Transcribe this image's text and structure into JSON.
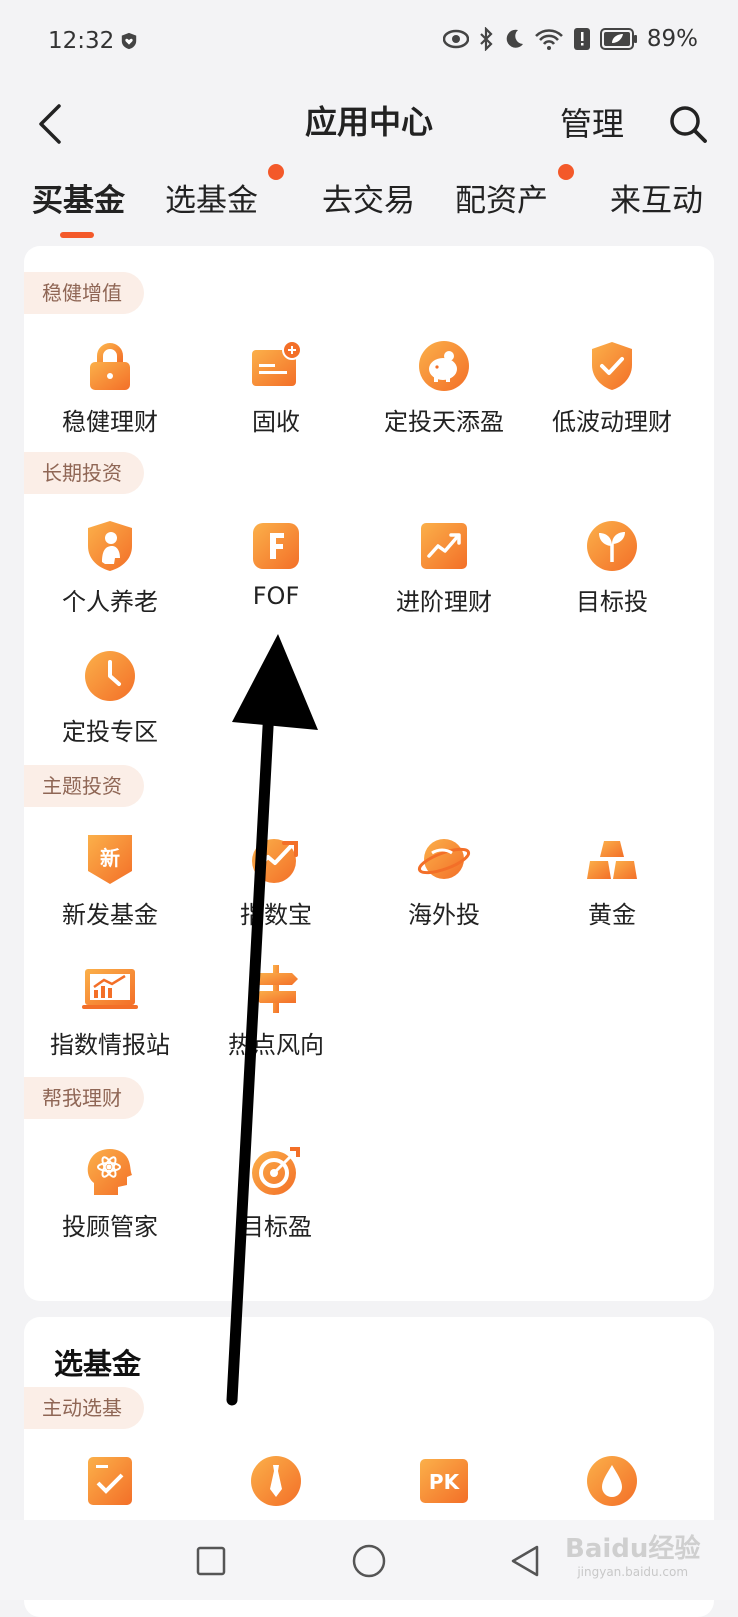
{
  "status_bar": {
    "time": "12:32",
    "battery": "89%",
    "icons": [
      "shield-heart-icon",
      "eye-icon",
      "bluetooth-icon",
      "moon-icon",
      "wifi-icon",
      "alert-icon",
      "battery-icon"
    ]
  },
  "header": {
    "title": "应用中心",
    "manage_label": "管理",
    "search_icon": "search-icon",
    "back_icon": "back-arrow-icon"
  },
  "tabs": [
    {
      "label": "买基金",
      "active": true,
      "dot": false
    },
    {
      "label": "选基金",
      "active": false,
      "dot": true
    },
    {
      "label": "去交易",
      "active": false,
      "dot": false
    },
    {
      "label": "配资产",
      "active": false,
      "dot": true
    },
    {
      "label": "来互动",
      "active": false,
      "dot": false
    }
  ],
  "sections": [
    {
      "tag": "稳健增值",
      "items": [
        {
          "label": "稳健理财",
          "icon": "lock-icon"
        },
        {
          "label": "固收",
          "icon": "fixed-income-card-icon"
        },
        {
          "label": "定投天添盈",
          "icon": "piggy-bank-icon"
        },
        {
          "label": "低波动理财",
          "icon": "shield-check-icon"
        }
      ]
    },
    {
      "tag": "长期投资",
      "items": [
        {
          "label": "个人养老",
          "icon": "elder-person-icon"
        },
        {
          "label": "FOF",
          "icon": "letter-f-icon"
        },
        {
          "label": "进阶理财",
          "icon": "trend-chart-icon"
        },
        {
          "label": "目标投",
          "icon": "sprout-icon"
        },
        {
          "label": "定投专区",
          "icon": "clock-icon"
        }
      ]
    },
    {
      "tag": "主题投资",
      "items": [
        {
          "label": "新发基金",
          "icon": "new-badge-icon",
          "badge": "新"
        },
        {
          "label": "指数宝",
          "icon": "index-chart-icon"
        },
        {
          "label": "海外投",
          "icon": "planet-icon"
        },
        {
          "label": "黄金",
          "icon": "gold-bars-icon"
        },
        {
          "label": "指数情报站",
          "icon": "report-board-icon"
        },
        {
          "label": "热点风向",
          "icon": "signpost-icon"
        }
      ]
    },
    {
      "tag": "帮我理财",
      "items": [
        {
          "label": "投顾管家",
          "icon": "advisor-head-icon"
        },
        {
          "label": "目标盈",
          "icon": "target-arrow-icon"
        }
      ]
    }
  ],
  "section2": {
    "title": "选基金",
    "tag": "主动选基",
    "items": [
      {
        "icon": "check-doc-icon"
      },
      {
        "icon": "manager-tie-icon"
      },
      {
        "icon": "pk-icon",
        "badge": "PK"
      },
      {
        "icon": "drop-icon"
      }
    ]
  },
  "nav": [
    "recent-apps-icon",
    "home-icon",
    "back-triangle-icon"
  ],
  "watermark": {
    "main": "Baidu经验",
    "sub": "jingyan.baidu.com"
  },
  "colors": {
    "accent": "#f3592a",
    "icon_orange": "#f58a2e",
    "pill_bg": "#fbeee7",
    "pill_text": "#8f6655"
  }
}
